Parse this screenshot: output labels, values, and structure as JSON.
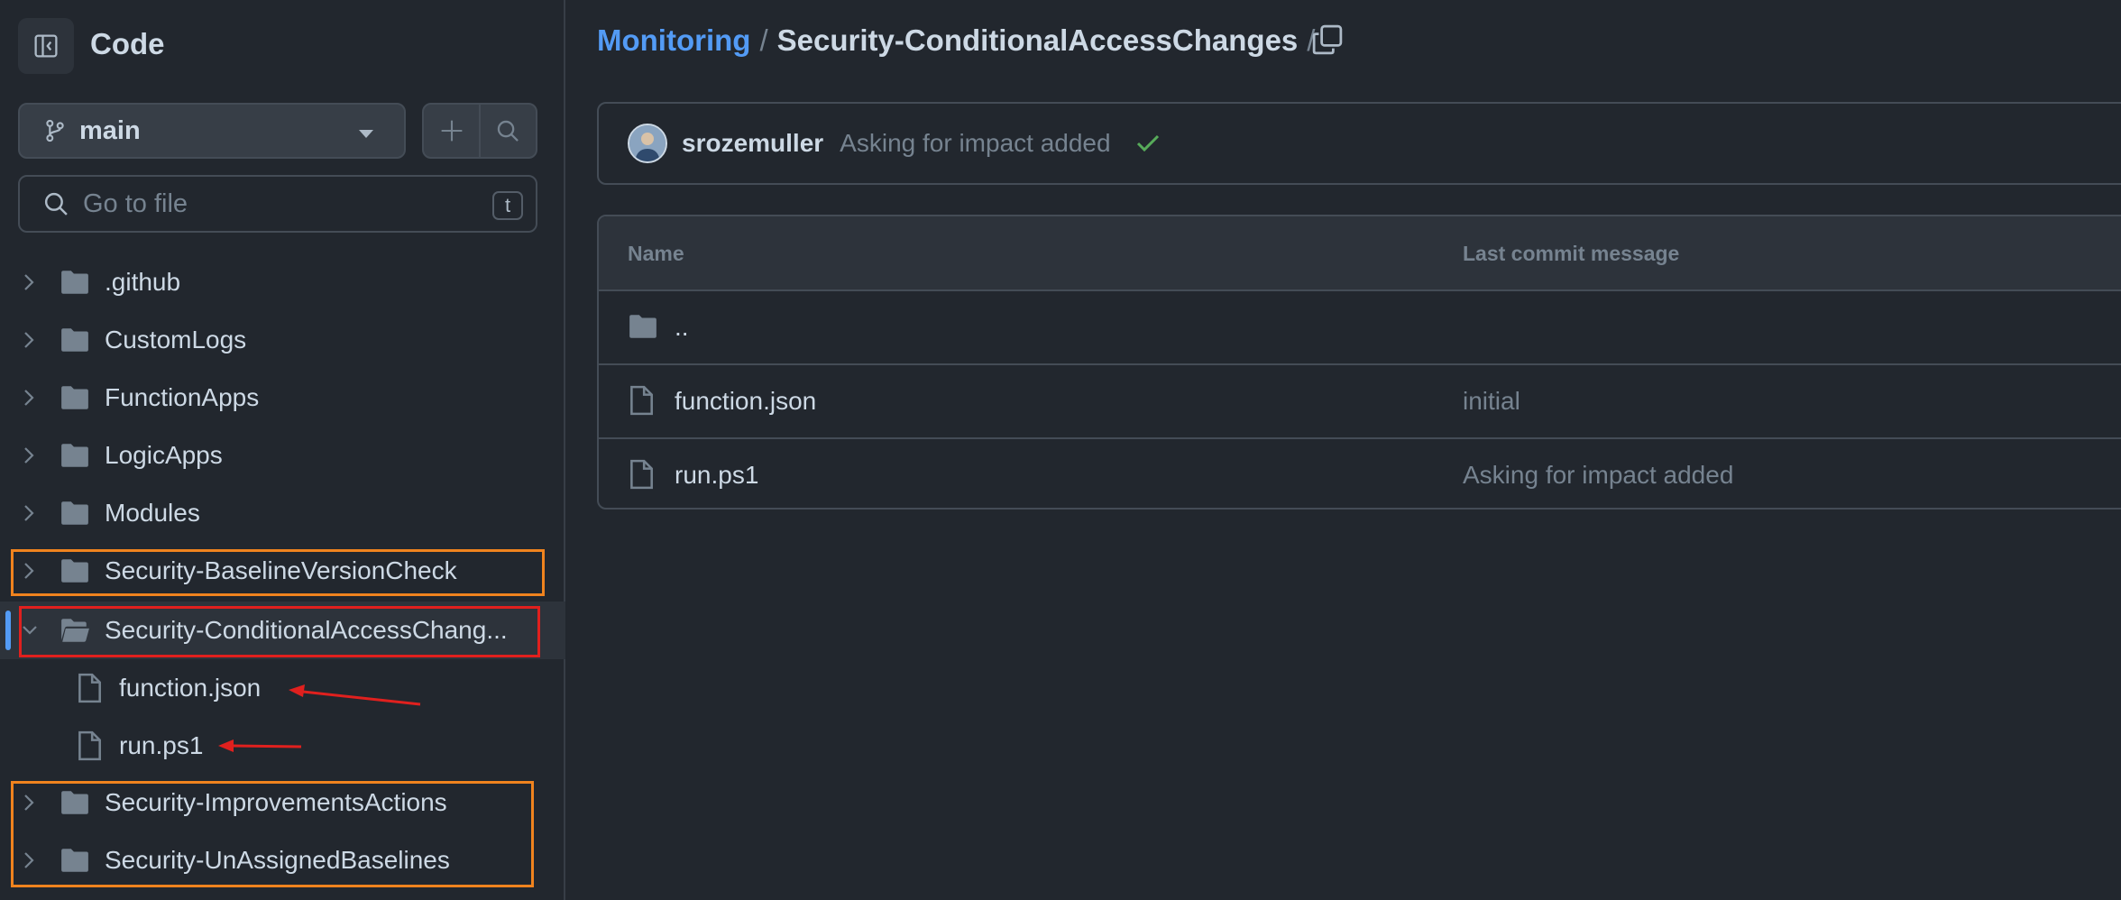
{
  "sidebar": {
    "title": "Code",
    "branch": {
      "label": "main"
    },
    "search": {
      "placeholder": "Go to file",
      "shortcut": "t"
    },
    "tree": [
      {
        "name": ".github",
        "type": "folder",
        "expanded": false
      },
      {
        "name": "CustomLogs",
        "type": "folder",
        "expanded": false
      },
      {
        "name": "FunctionApps",
        "type": "folder",
        "expanded": false
      },
      {
        "name": "LogicApps",
        "type": "folder",
        "expanded": false
      },
      {
        "name": "Modules",
        "type": "folder",
        "expanded": false
      },
      {
        "name": "Security-BaselineVersionCheck",
        "type": "folder",
        "expanded": false
      },
      {
        "name": "Security-ConditionalAccessChang...",
        "type": "folder",
        "expanded": true,
        "selected": true
      },
      {
        "name": "function.json",
        "type": "file"
      },
      {
        "name": "run.ps1",
        "type": "file"
      },
      {
        "name": "Security-ImprovementsActions",
        "type": "folder",
        "expanded": false
      },
      {
        "name": "Security-UnAssignedBaselines",
        "type": "folder",
        "expanded": false
      }
    ]
  },
  "breadcrumb": {
    "repo": "Monitoring",
    "separator": "/",
    "current": "Security-ConditionalAccessChanges",
    "trailing": "/"
  },
  "commit": {
    "author": "srozemuller",
    "message": "Asking for impact added",
    "status": "success-check-icon"
  },
  "table": {
    "headers": {
      "name": "Name",
      "message": "Last commit message"
    },
    "parent": "..",
    "rows": [
      {
        "name": "function.json",
        "message": "initial"
      },
      {
        "name": "run.ps1",
        "message": "Asking for impact added"
      }
    ]
  },
  "colors": {
    "background": "#22272e",
    "accent": "#539bf5",
    "annotation_orange": "#f0831e",
    "annotation_red": "#e0201e",
    "success": "#57ab5a"
  }
}
